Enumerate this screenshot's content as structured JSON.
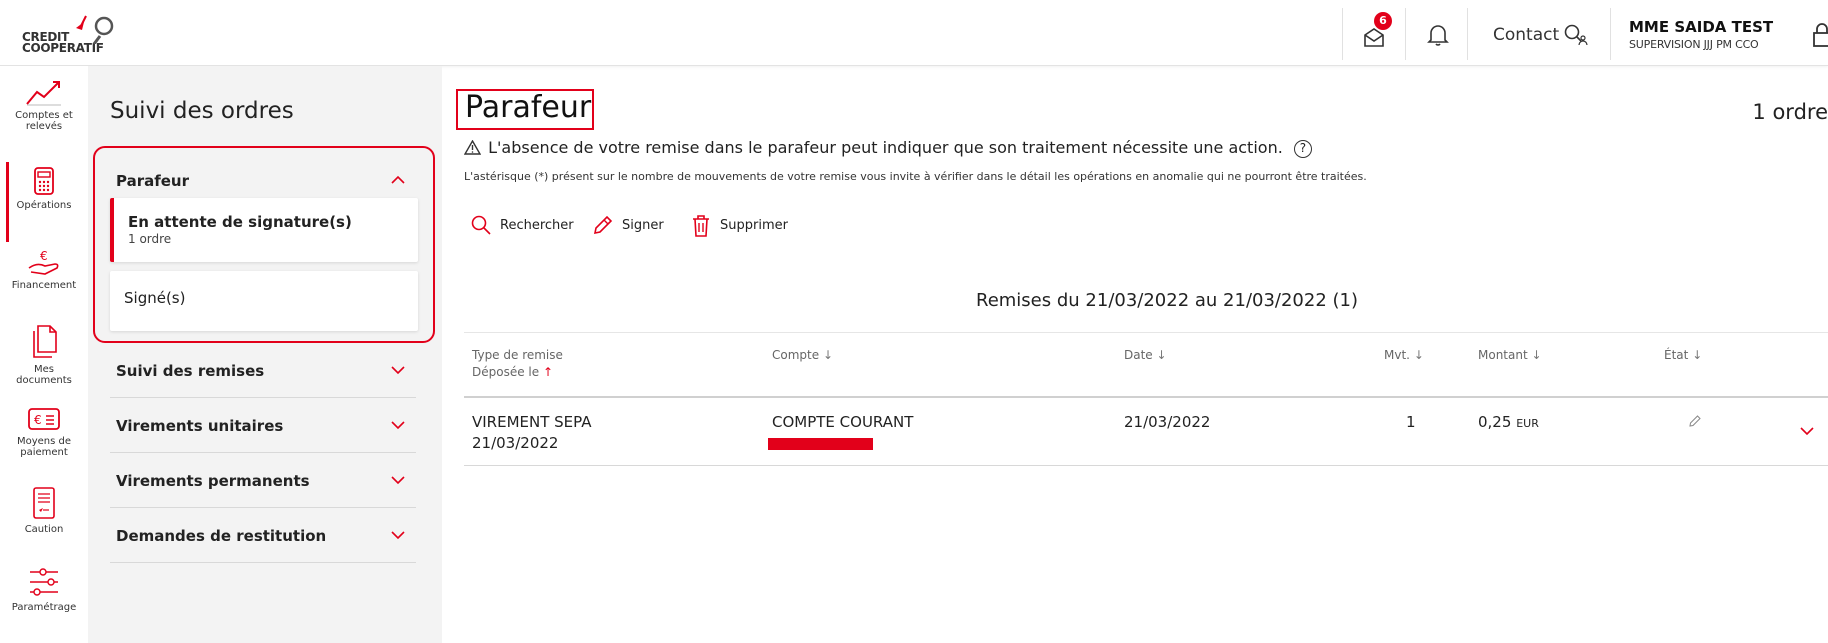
{
  "header": {
    "brand_line1": "CREDIT",
    "brand_line2": "COOPERATIF",
    "mail_badge": "6",
    "contact_label": "Contact",
    "user_name": "MME SAIDA TEST",
    "user_sub": "SUPERVISION JJJ PM CCO"
  },
  "iconnav": {
    "items": [
      {
        "label1": "Comptes et",
        "label2": "relevés",
        "icon": "chart-line-icon"
      },
      {
        "label1": "Opérations",
        "label2": "",
        "icon": "calculator-icon"
      },
      {
        "label1": "Financement",
        "label2": "",
        "icon": "euro-hand-icon"
      },
      {
        "label1": "Mes",
        "label2": "documents",
        "icon": "documents-icon"
      },
      {
        "label1": "Moyens de",
        "label2": "paiement",
        "icon": "payment-card-icon"
      },
      {
        "label1": "Caution",
        "label2": "",
        "icon": "caution-document-icon"
      },
      {
        "label1": "Paramétrage",
        "label2": "",
        "icon": "sliders-icon"
      }
    ]
  },
  "subnav": {
    "title": "Suivi des ordres",
    "parafeur": "Parafeur",
    "pending_title": "En attente de signature(s)",
    "pending_count": "1 ordre",
    "signed": "Signé(s)",
    "sections": [
      "Suivi des remises",
      "Virements unitaires",
      "Virements permanents",
      "Demandes de restitution"
    ]
  },
  "main": {
    "title": "Parafeur",
    "count": "1 ordre",
    "warning": "L'absence de votre remise dans le parafeur peut indiquer que son traitement nécessite une action.",
    "note": "L'astérisque (*) présent sur le nombre de mouvements de votre remise vous invite à vérifier dans le détail les opérations en anomalie qui ne pourront être traitées.",
    "actions": {
      "search": "Rechercher",
      "sign": "Signer",
      "delete": "Supprimer"
    },
    "remises_title": "Remises du 21/03/2022 au 21/03/2022 (1)"
  },
  "table": {
    "headers": {
      "type": "Type de remise",
      "deposed": "Déposée le",
      "account": "Compte",
      "date": "Date",
      "mvt": "Mvt.",
      "amount": "Montant",
      "state": "État"
    },
    "rows": [
      {
        "type": "VIREMENT SEPA",
        "deposed": "21/03/2022",
        "account": "COMPTE COURANT",
        "date": "21/03/2022",
        "mvt": "1",
        "amount": "0,25",
        "currency": "EUR"
      }
    ]
  },
  "colors": {
    "accent": "#e2001a",
    "sidebar_bg": "#f3f3f3"
  }
}
